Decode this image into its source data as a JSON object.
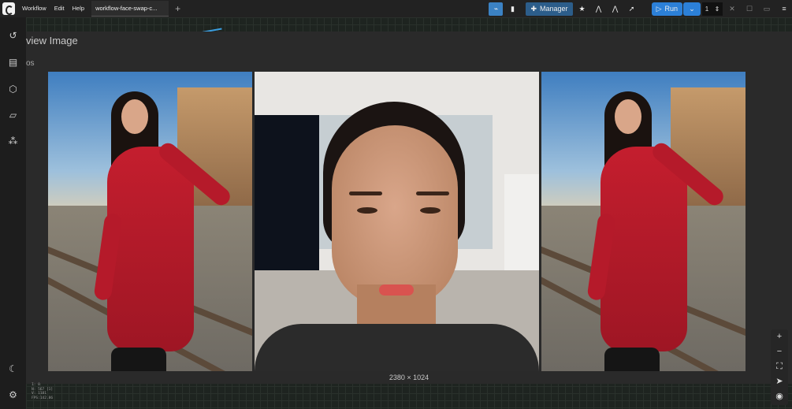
{
  "menu": {
    "workflow": "Workflow",
    "edit": "Edit",
    "help": "Help"
  },
  "tab": {
    "name": "workflow-face-swap-c..."
  },
  "toolbar": {
    "manager_label": "Manager",
    "run_label": "Run",
    "batch_count": "1"
  },
  "node": {
    "title": "view Image",
    "subtitle": "os",
    "image_size": "2380 × 1024"
  },
  "stats": {
    "line1": "I: 0",
    "line2": "N: 567 [1]",
    "line3": "V: 1181",
    "line4": "FPS:142.86"
  },
  "icons": {
    "sidebar": [
      "history-icon",
      "queue-icon",
      "cube-icon",
      "folder-icon",
      "nodes-icon",
      "theme-moon-icon",
      "settings-gear-icon"
    ],
    "tools": [
      "zoom-in-icon",
      "zoom-out-icon",
      "fit-view-icon",
      "select-mode-icon",
      "visibility-eye-icon"
    ]
  },
  "colors": {
    "accent": "#2c80d8",
    "canvas": "#1e2420",
    "dress": "#c41e2e"
  }
}
